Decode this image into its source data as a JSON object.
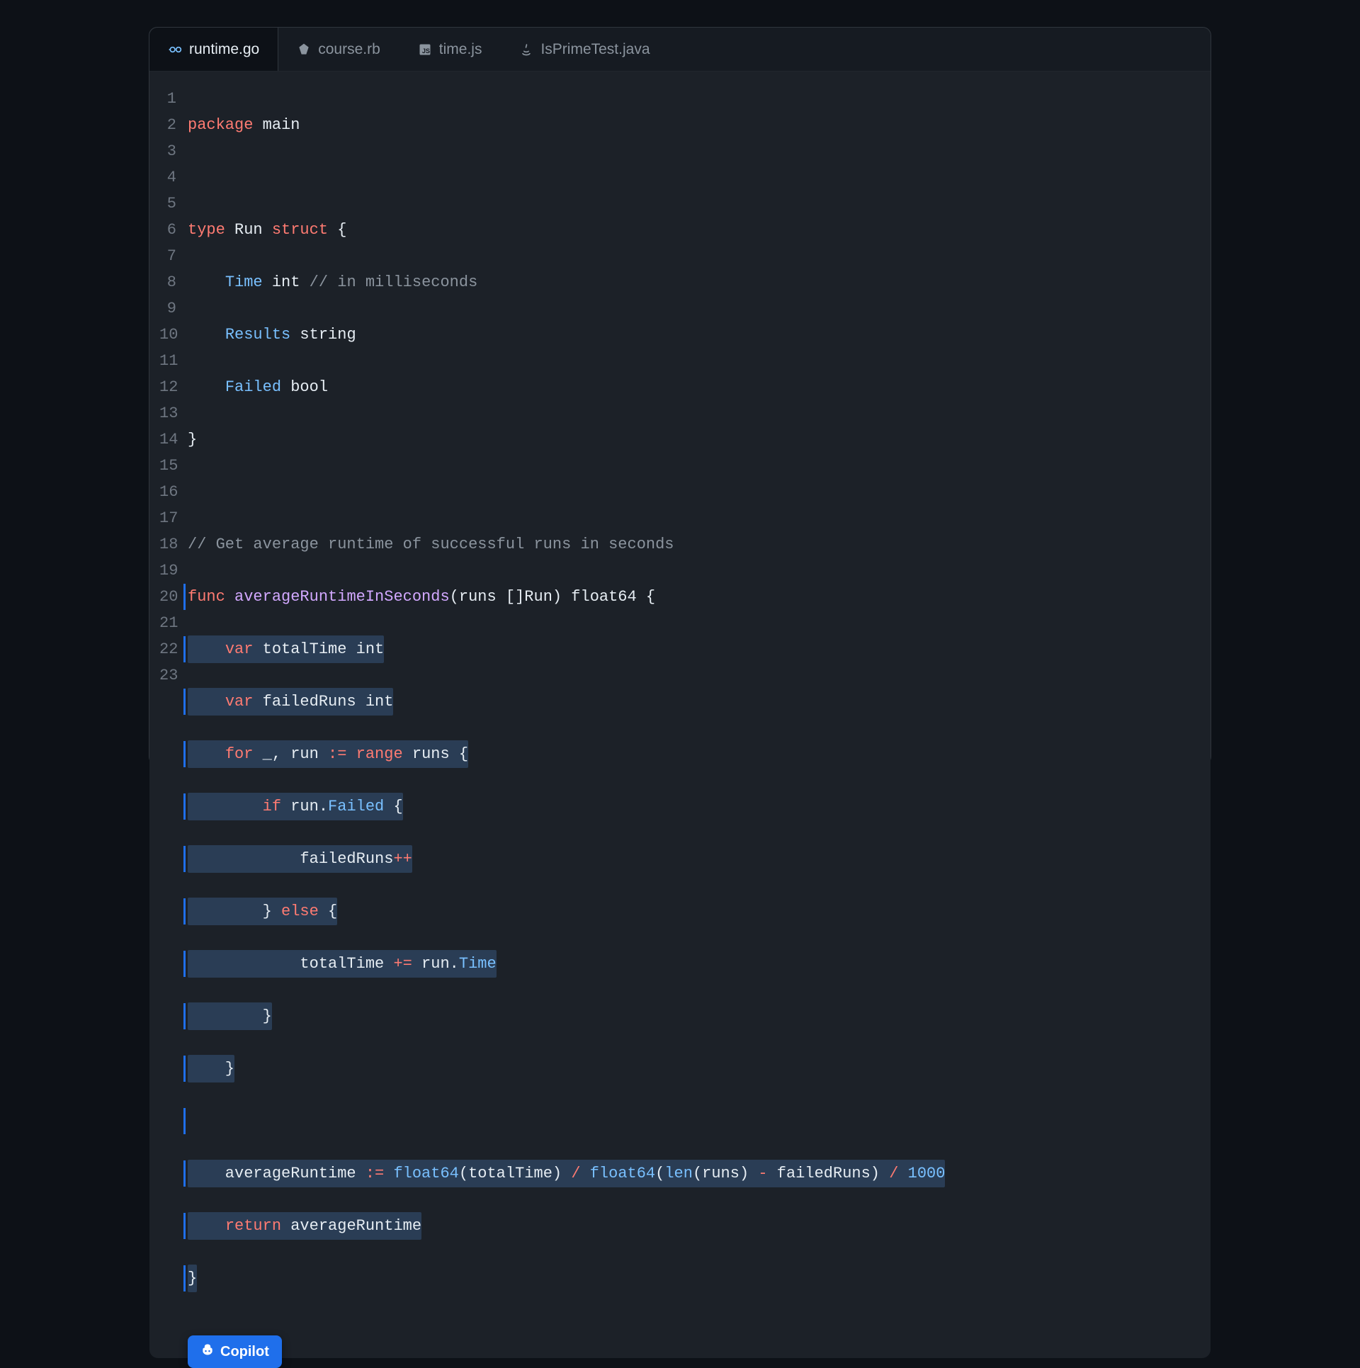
{
  "tabs": [
    {
      "label": "runtime.go",
      "icon": "go-icon",
      "active": true
    },
    {
      "label": "course.rb",
      "icon": "ruby-icon",
      "active": false
    },
    {
      "label": "time.js",
      "icon": "js-icon",
      "active": false
    },
    {
      "label": "IsPrimeTest.java",
      "icon": "java-icon",
      "active": false
    }
  ],
  "line_numbers": [
    "1",
    "2",
    "3",
    "4",
    "5",
    "6",
    "7",
    "8",
    "9",
    "10",
    "11",
    "12",
    "13",
    "14",
    "15",
    "16",
    "17",
    "18",
    "19",
    "20",
    "21",
    "22",
    "23"
  ],
  "code": {
    "l1": {
      "a": "package",
      "b": " main"
    },
    "l2": "",
    "l3": {
      "a": "type",
      "b": " Run ",
      "c": "struct",
      "d": " {"
    },
    "l4": {
      "a": "    ",
      "b": "Time",
      "c": " int ",
      "d": "// in milliseconds"
    },
    "l5": {
      "a": "    ",
      "b": "Results",
      "c": " string"
    },
    "l6": {
      "a": "    ",
      "b": "Failed",
      "c": " bool"
    },
    "l7": "}",
    "l8": "",
    "l9": "// Get average runtime of successful runs in seconds",
    "l10": {
      "a": "func",
      "b": " ",
      "c": "averageRuntimeInSeconds",
      "d": "(runs []Run) float64 {"
    },
    "l11": {
      "a": "    ",
      "b": "var",
      "c": " totalTime int"
    },
    "l12": {
      "a": "    ",
      "b": "var",
      "c": " failedRuns int"
    },
    "l13": {
      "a": "    ",
      "b": "for",
      "c": " _, run ",
      "d": ":=",
      "e": " ",
      "f": "range",
      "g": " runs {"
    },
    "l14": {
      "a": "        ",
      "b": "if",
      "c": " run.",
      "d": "Failed",
      "e": " {"
    },
    "l15": {
      "a": "            failedRuns",
      "b": "++"
    },
    "l16": {
      "a": "        } ",
      "b": "else",
      "c": " {"
    },
    "l17": {
      "a": "            totalTime ",
      "b": "+=",
      "c": " run.",
      "d": "Time"
    },
    "l18": "        }",
    "l19": "    }",
    "l20": "",
    "l21": {
      "a": "    averageRuntime ",
      "b": ":=",
      "c": " ",
      "d": "float64",
      "e": "(totalTime) ",
      "f": "/",
      "g": " ",
      "h": "float64",
      "i": "(",
      "j": "len",
      "k": "(runs) ",
      "l": "-",
      "m": " failedRuns) ",
      "n": "/",
      "o": " ",
      "p": "1000"
    },
    "l22": {
      "a": "    ",
      "b": "return",
      "c": " averageRuntime"
    },
    "l23": "}"
  },
  "badge": {
    "label": "Copilot"
  }
}
